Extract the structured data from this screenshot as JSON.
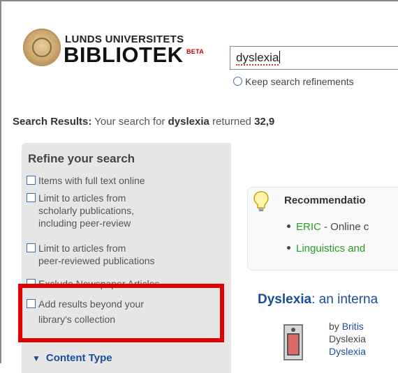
{
  "header": {
    "logo_top": "LUNDS UNIVERSITETS",
    "logo_main": "BIBLIOTEK",
    "logo_badge": "BETA"
  },
  "search": {
    "value": "dyslexia",
    "keep_refinements_label": "Keep search refinements"
  },
  "results_summary": {
    "label": "Search Results:",
    "text_before": "Your search for",
    "term": "dyslexia",
    "text_after": "returned",
    "count": "32,9"
  },
  "refine": {
    "title": "Refine your search",
    "options": [
      {
        "lines": [
          "Items with full text online"
        ],
        "checked": false
      },
      {
        "lines": [
          "Limit to articles from",
          "scholarly publications,",
          "including peer-review"
        ],
        "checked": false
      },
      {
        "lines": [
          "Limit to articles from",
          "peer-reviewed publications"
        ],
        "checked": false
      },
      {
        "lines": [
          "Exclude Newspaper Articles"
        ],
        "checked": false
      },
      {
        "lines": [
          "Add results beyond your",
          "library's collection"
        ],
        "checked": false
      }
    ],
    "content_type_label": "Content Type"
  },
  "recommendations": {
    "title": "Recommendatio",
    "items": [
      {
        "link": "ERIC",
        "rest": " - Online c"
      },
      {
        "link": "Linguistics and",
        "rest": ""
      }
    ]
  },
  "result": {
    "title_bold": "Dyslexia",
    "title_rest": ": an interna",
    "by_prefix": "by ",
    "author": "Britis",
    "line2": "Dyslexia",
    "line3": "Dyslexia"
  },
  "colors": {
    "link": "#1a4d99",
    "recommend_link": "#22a020",
    "highlight": "#e00000",
    "panel": "#e6e6e6"
  }
}
